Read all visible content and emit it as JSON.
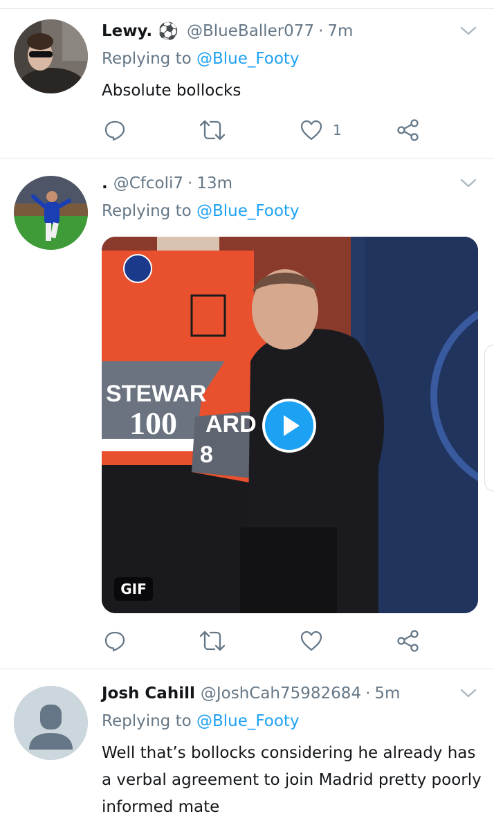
{
  "colors": {
    "accent": "#1da1f2",
    "muted": "#657786",
    "text": "#14171a",
    "divider": "#e1e8ed"
  },
  "icons": {
    "reply": "reply-icon",
    "retweet": "retweet-icon",
    "like": "heart-icon",
    "share": "share-icon",
    "caret": "chevron-down-icon",
    "play": "play-icon"
  },
  "tweets": [
    {
      "name": "Lewy.",
      "name_emoji": "⚽",
      "handle": "@BlueBaller077",
      "separator": "·",
      "time": "7m",
      "replying_prefix": "Replying to",
      "replying_to": "@Blue_Footy",
      "text": "Absolute bollocks",
      "like_count": "1"
    },
    {
      "name": ".",
      "handle": "@Cfcoli7",
      "separator": "·",
      "time": "13m",
      "replying_prefix": "Replying to",
      "replying_to": "@Blue_Footy",
      "media": {
        "badge": "GIF",
        "vest_text_top": "STEWAR",
        "vest_text_number": "100",
        "vest_text_right": "ARD",
        "vest_text_8": "8"
      }
    },
    {
      "name": "Josh Cahill",
      "handle": "@JoshCah75982684",
      "separator": "·",
      "time": "5m",
      "replying_prefix": "Replying to",
      "replying_to": "@Blue_Footy",
      "text_lines": [
        "Well that’s bollocks considering he already has",
        "a verbal agreement to join Madrid pretty poorly",
        "informed mate"
      ]
    }
  ]
}
